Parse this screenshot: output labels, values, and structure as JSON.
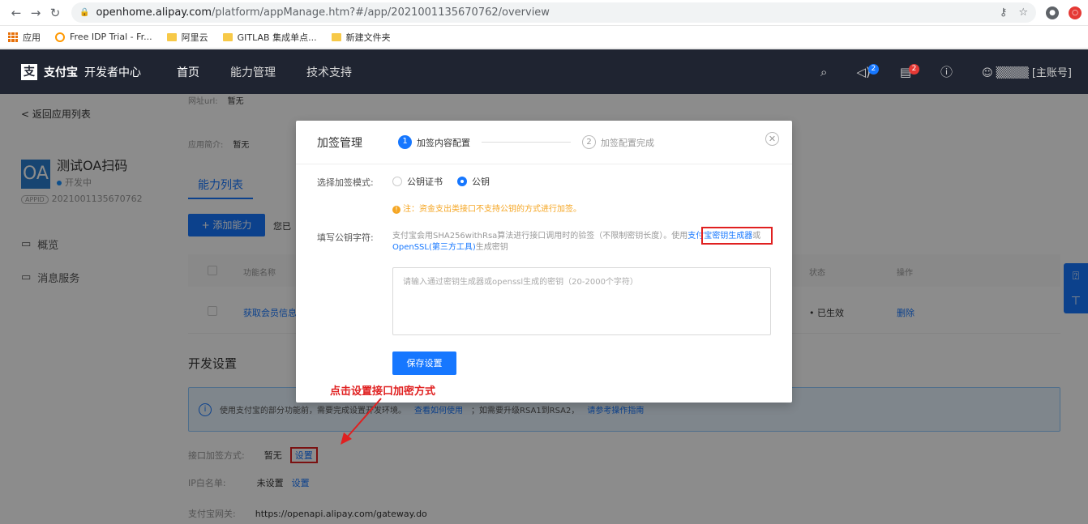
{
  "browser": {
    "url_host": "openhome.alipay.com",
    "url_path": "/platform/appManage.htm?#/app/2021001135670762/overview",
    "bookmarks": [
      "应用",
      "Free IDP Trial - Fr...",
      "阿里云",
      "GITLAB 集成单点...",
      "新建文件夹"
    ]
  },
  "topnav": {
    "brand_logo": "支",
    "brand_name": "支付宝",
    "brand_sub": "开发者中心",
    "menu": [
      "首页",
      "能力管理",
      "技术支持"
    ],
    "badge1": "2",
    "badge2": "2",
    "user": "[主账号]"
  },
  "sidebar": {
    "back": "< 返回应用列表",
    "app_logo": "OA",
    "app_name": "测试OA扫码",
    "app_status": "开发中",
    "appid_tag": "APPID",
    "appid": "2021001135670762",
    "nav": [
      "概览",
      "消息服务"
    ]
  },
  "main": {
    "url_label": "网址url:",
    "url_value": "暂无",
    "intro_label": "应用简介:",
    "intro_value": "暂无",
    "tab": "能力列表",
    "add_button": "+ 添加能力",
    "auth_note": "您已",
    "col_name": "功能名称",
    "col_status": "状态",
    "col_action": "操作",
    "row_name": "获取会员信息",
    "row_status": "• 已生效",
    "row_action": "删除",
    "section_title": "开发设置",
    "info_text": "使用支付宝的部分功能前，需要完成设置开发环境。",
    "info_link1": "查看如何使用",
    "info_text2": "；如需要升级RSA1到RSA2，",
    "info_link2": "请参考操作指南",
    "encrypt_label": "接口加签方式:",
    "encrypt_value": "暂无",
    "encrypt_link": "设置",
    "ip_label": "IP白名单:",
    "ip_value": "未设置",
    "ip_link": "设置",
    "gateway_label": "支付宝网关:",
    "gateway_value": "https://openapi.alipay.com/gateway.do"
  },
  "modal": {
    "title": "加签管理",
    "step1_num": "1",
    "step1": "加签内容配置",
    "step2_num": "2",
    "step2": "加签配置完成",
    "mode_label": "选择加签模式:",
    "opt_cert": "公钥证书",
    "opt_key": "公钥",
    "warn": "注：资金支出类接口不支持公钥的方式进行加签。",
    "key_label": "填写公钥字符:",
    "hint_text": "支付宝会用SHA256withRsa算法进行接口调用时的验签（不限制密钥长度）。使用",
    "hint_link1": "支付宝密钥生成器",
    "hint_or": "或",
    "hint_link2": "OpenSSL(第三方工具)",
    "hint_tail": "生成密钥",
    "placeholder": "请输入通过密钥生成器或openssl生成的密钥（20-2000个字符）",
    "save": "保存设置"
  },
  "annotation": "点击设置接口加密方式",
  "colors": {
    "accent": "#1677ff",
    "nav_bg": "#1f2431",
    "annotation_red": "#e02020",
    "warn": "#f5a623"
  }
}
